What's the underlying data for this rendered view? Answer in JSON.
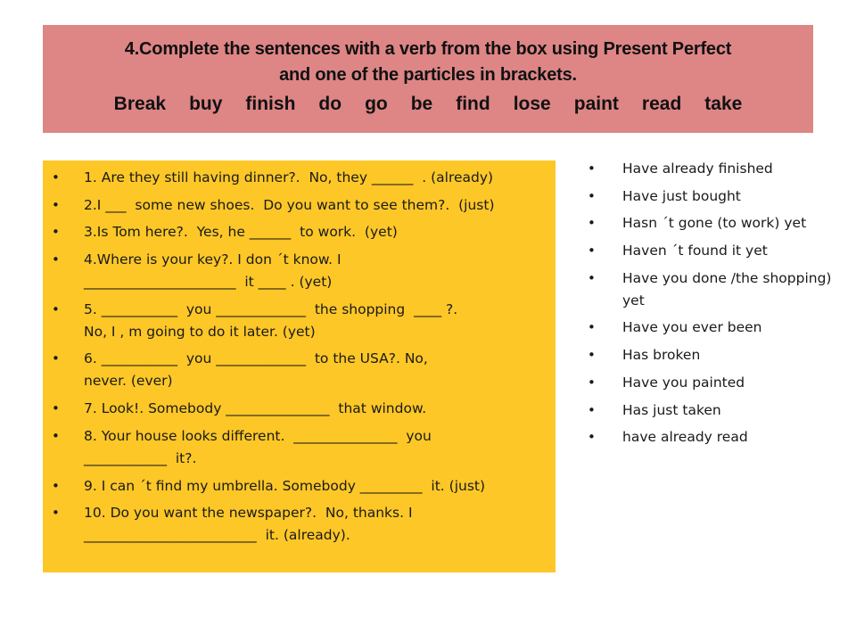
{
  "title": {
    "line1": "4.Complete the sentences with a verb from the box using Present Perfect",
    "line2": "and one of the particles in brackets.",
    "verbs": [
      "Break",
      "buy",
      "finish",
      "do",
      "go",
      "be",
      "find",
      "lose",
      "paint",
      "read",
      "take"
    ]
  },
  "exercise": {
    "bullet": "•",
    "items": [
      "1. Are they still having dinner?.  No, they ______  . (already)",
      "2.I ___  some new shoes.  Do you want to see them?.  (just)",
      "3.Is Tom here?.  Yes, he ______  to work.  (yet)",
      "4.Where is your key?. I don ´t know. I\n______________________  it ____ . (yet)",
      "5. ___________  you _____________  the shopping  ____ ?.\nNo, I , m going to do it later. (yet)",
      "6. ___________  you _____________  to the USA?. No,\nnever. (ever)",
      "7. Look!. Somebody _______________  that window.",
      "8. Your house looks different.  _______________  you\n____________  it?.",
      "9. I can ´t find my umbrella. Somebody _________  it. (just)",
      "10. Do you want the newspaper?.  No, thanks. I\n_________________________  it. (already)."
    ]
  },
  "answers": {
    "bullet": "•",
    "items": [
      "Have already finished",
      "Have just bought",
      "Hasn ´t gone (to work) yet",
      "Haven ´t found it yet",
      "Have you done /the shopping) yet",
      "Have you ever been",
      "Has broken",
      "Have you painted",
      "Has just taken",
      "have already read"
    ]
  },
  "colors": {
    "title_bg": "#de8585",
    "exercise_bg": "#fdc727",
    "page_bg": "#ffffff"
  }
}
